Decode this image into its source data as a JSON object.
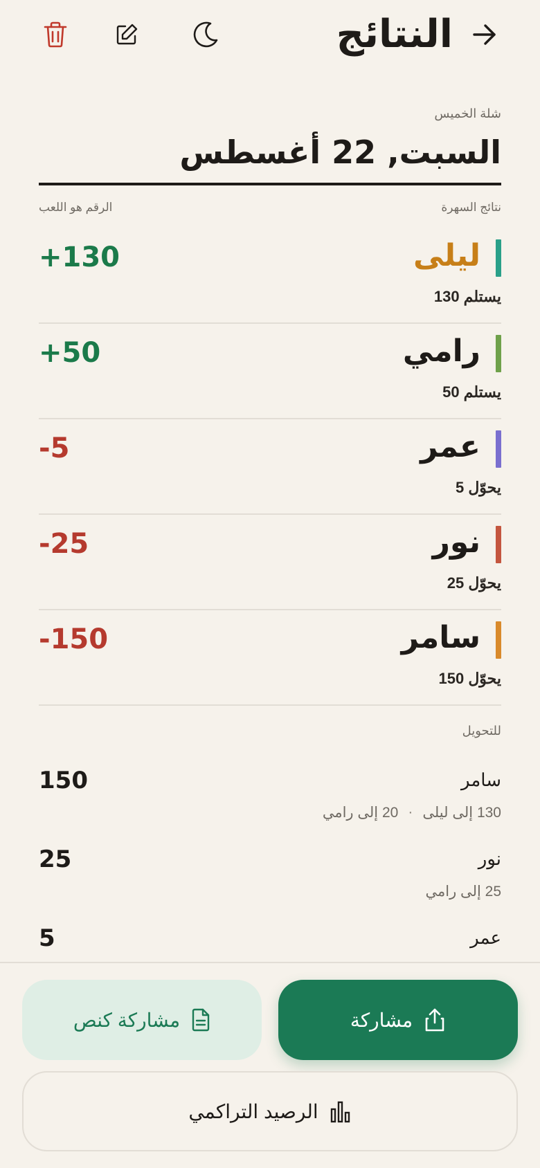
{
  "header": {
    "title": "النتائج",
    "icons": [
      "arrow-right-icon",
      "moon-icon",
      "edit-icon",
      "trash-icon"
    ]
  },
  "session": {
    "group": "شلة الخميس",
    "date": "السبت, 22 أغسطس",
    "results_label": "نتائج السهرة",
    "note": "الرقم هو اللعب"
  },
  "players": [
    {
      "name": "ليلى",
      "note": "يستلم 130",
      "score": "+130",
      "bar_color": "#2aa089",
      "name_color": "#c77f18",
      "score_color": "#1b7a4a"
    },
    {
      "name": "رامي",
      "note": "يستلم 50",
      "score": "+50",
      "bar_color": "#6fa14a",
      "name_color": "#1e1b18",
      "score_color": "#1b7a4a"
    },
    {
      "name": "عمر",
      "note": "يحوّل 5",
      "score": "-5",
      "bar_color": "#7a6fcf",
      "name_color": "#1e1b18",
      "score_color": "#b53a2e"
    },
    {
      "name": "نور",
      "note": "يحوّل 25",
      "score": "-25",
      "bar_color": "#c4563f",
      "name_color": "#1e1b18",
      "score_color": "#b53a2e"
    },
    {
      "name": "سامر",
      "note": "يحوّل 150",
      "score": "-150",
      "bar_color": "#d98a2b",
      "name_color": "#1e1b18",
      "score_color": "#b53a2e"
    }
  ],
  "transfers": {
    "title": "للتحويل",
    "items": [
      {
        "name": "سامر",
        "amount": "150",
        "details": [
          "130 إلى ليلى",
          "20 إلى رامي"
        ]
      },
      {
        "name": "نور",
        "amount": "25",
        "details": [
          "25 إلى رامي"
        ]
      },
      {
        "name": "عمر",
        "amount": "5",
        "details": []
      }
    ]
  },
  "actions": {
    "share_label": "مشاركة",
    "share_clean_label": "مشاركة كنص",
    "balance_label": "الرصيد التراكمي"
  },
  "colors": {
    "background": "#f6f2eb",
    "primary": "#1b7a55",
    "positive": "#1b7a4a",
    "negative": "#b53a2e",
    "trash": "#c0392b"
  }
}
